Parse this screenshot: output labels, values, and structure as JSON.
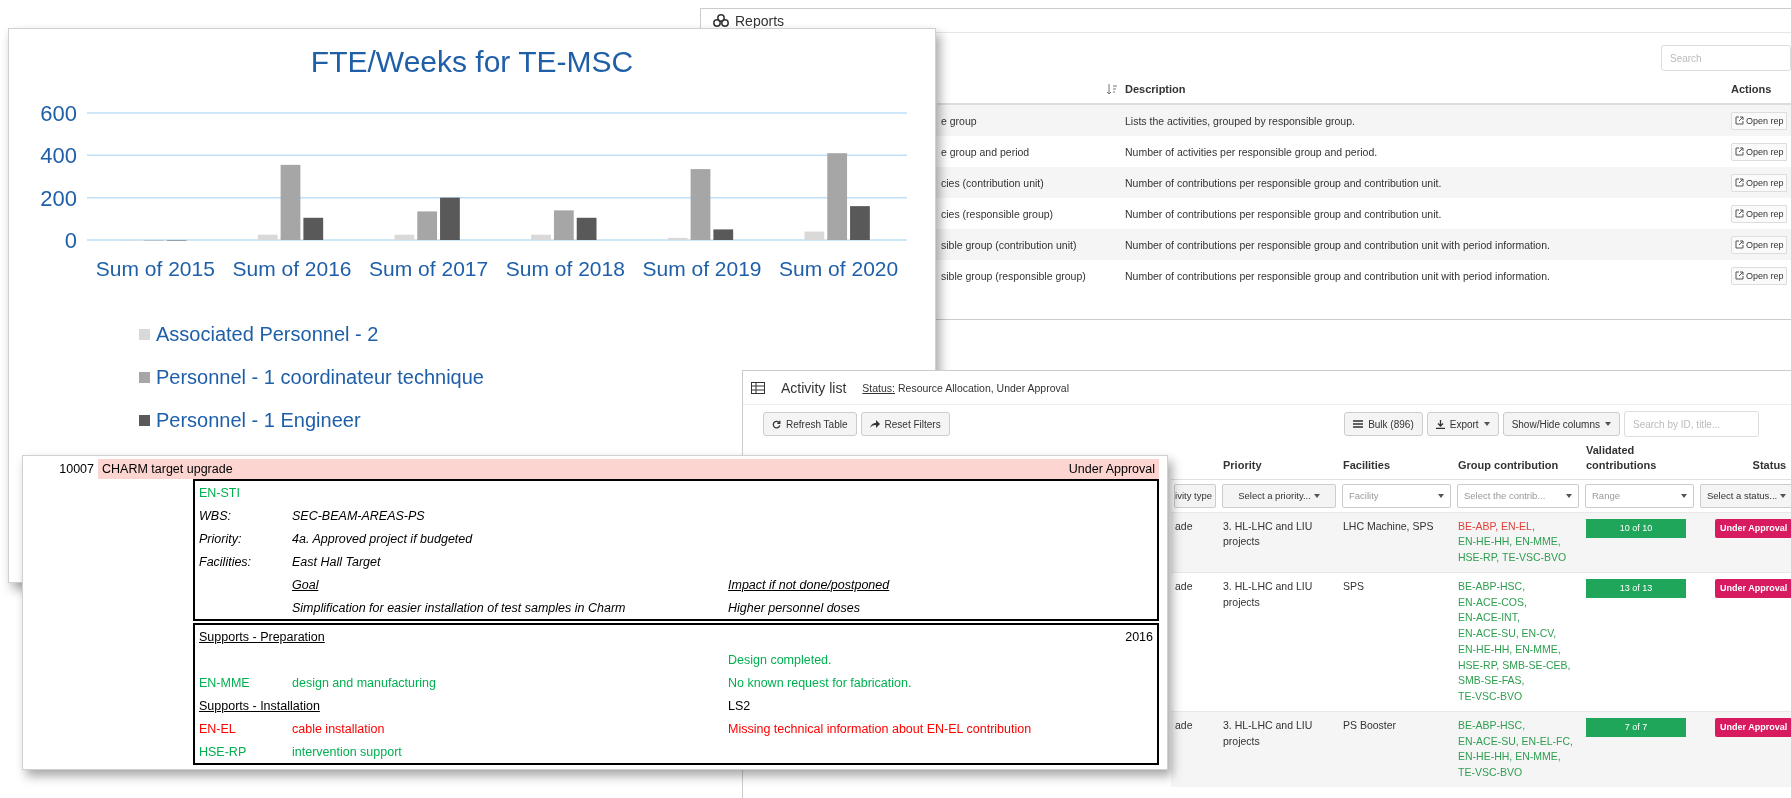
{
  "reports": {
    "title": "Reports",
    "search": {
      "placeholder": "Search"
    },
    "columns": [
      "Description",
      "Actions"
    ],
    "rows": [
      {
        "name": "e group",
        "description": "Lists the activities, grouped by responsible group.",
        "action": "Open rep"
      },
      {
        "name": "e group and period",
        "description": "Number of activities per responsible group and period.",
        "action": "Open rep"
      },
      {
        "name": "cies (contribution unit)",
        "description": "Number of contributions per responsible group and contribution unit.",
        "action": "Open rep"
      },
      {
        "name": "cies (responsible group)",
        "description": "Number of contributions per responsible group and contribution unit.",
        "action": "Open rep"
      },
      {
        "name": "sible group (contribution unit)",
        "description": "Number of contributions per responsible group and contribution unit with period information.",
        "action": "Open rep"
      },
      {
        "name": "sible group (responsible group)",
        "description": "Number of contributions per responsible group and contribution unit with period information.",
        "action": "Open rep"
      }
    ]
  },
  "chart": {
    "chart_data": {
      "type": "bar",
      "title": "FTE/Weeks for TE-MSC",
      "categories": [
        "Sum of 2015",
        "Sum of 2016",
        "Sum of 2017",
        "Sum of 2018",
        "Sum of 2019",
        "Sum of 2020"
      ],
      "ylim": [
        0,
        600
      ],
      "yticks": [
        0,
        200,
        400,
        600
      ],
      "series": [
        {
          "name": "Associated Personnel - 2",
          "color": "#d9d9d9",
          "values": [
            0,
            25,
            25,
            25,
            10,
            40
          ]
        },
        {
          "name": "Personnel - 1 coordinateur technique",
          "color": "#a6a6a6",
          "values": [
            0,
            355,
            135,
            140,
            335,
            410
          ]
        },
        {
          "name": "Personnel - 1 Engineer",
          "color": "#595959",
          "values": [
            0,
            105,
            200,
            105,
            50,
            160
          ]
        }
      ]
    }
  },
  "activity_list": {
    "title": "Activity list",
    "status_label": "Status:",
    "status_value": "Resource Allocation, Under Approval",
    "toolbar_left": [
      "Refresh Table",
      "Reset Filters"
    ],
    "bulk": "Bulk (896)",
    "export": "Export",
    "show_hide": "Show/Hide columns",
    "search": {
      "placeholder": "Search by ID, title..."
    },
    "columns": [
      "Priority",
      "Facilities",
      "Group contribution",
      "Validated contributions",
      "Status"
    ],
    "filters": [
      {
        "text": "ivity type",
        "kind": "select"
      },
      {
        "text": "Select a priority...",
        "kind": "select"
      },
      {
        "text": "Facility",
        "kind": "input"
      },
      {
        "text": "Select the contrib...",
        "kind": "input"
      },
      {
        "text": "Range",
        "kind": "input"
      },
      {
        "text": "Select a status...",
        "kind": "select"
      }
    ],
    "rows": [
      {
        "name": "ade",
        "priority": "3. HL-LHC and LIU projects",
        "facilities": "LHC Machine, SPS",
        "groups": [
          {
            "text": "BE-ABP,",
            "color": "#e0403a"
          },
          {
            "text": "EN-EL,",
            "color": "#e0403a"
          },
          {
            "text": "EN-HE-HH,",
            "color": "#2e9e4f"
          },
          {
            "text": "EN-MME,",
            "color": "#2e9e4f"
          },
          {
            "text": "HSE-RP,",
            "color": "#2e9e4f"
          },
          {
            "text": "TE-VSC-BVO",
            "color": "#2e9e4f"
          }
        ],
        "validated": "10 of 10",
        "status": "Under Approval"
      },
      {
        "name": "ade",
        "priority": "3. HL-LHC and LIU projects",
        "facilities": "SPS",
        "groups": [
          {
            "text": "BE-ABP-HSC,",
            "color": "#2e9e4f"
          },
          {
            "text": "EN-ACE-COS,",
            "color": "#2e9e4f"
          },
          {
            "text": "EN-ACE-INT,",
            "color": "#2e9e4f"
          },
          {
            "text": "EN-ACE-SU,",
            "color": "#2e9e4f"
          },
          {
            "text": "EN-CV,",
            "color": "#2e9e4f"
          },
          {
            "text": "EN-HE-HH,",
            "color": "#2e9e4f"
          },
          {
            "text": "EN-MME,",
            "color": "#2e9e4f"
          },
          {
            "text": "HSE-RP,",
            "color": "#2e9e4f"
          },
          {
            "text": "SMB-SE-CEB,",
            "color": "#2e9e4f"
          },
          {
            "text": "SMB-SE-FAS,",
            "color": "#2e9e4f"
          },
          {
            "text": "TE-VSC-BVO",
            "color": "#2e9e4f"
          }
        ],
        "validated": "13 of 13",
        "status": "Under Approval"
      },
      {
        "name": "ade",
        "priority": "3. HL-LHC and LIU projects",
        "facilities": "PS Booster",
        "groups": [
          {
            "text": "BE-ABP-HSC,",
            "color": "#2e9e4f"
          },
          {
            "text": "EN-ACE-SU,",
            "color": "#2e9e4f"
          },
          {
            "text": "EN-EL-FC,",
            "color": "#2e9e4f"
          },
          {
            "text": "EN-HE-HH,",
            "color": "#2e9e4f"
          },
          {
            "text": "EN-MME,",
            "color": "#2e9e4f"
          },
          {
            "text": "TE-VSC-BVO",
            "color": "#2e9e4f"
          }
        ],
        "validated": "7 of 7",
        "status": "Under Approval"
      }
    ]
  },
  "activity_card": {
    "id": "10007",
    "title": "CHARM target upgrade",
    "status": "Under Approval",
    "group": {
      "text": "EN-STI",
      "color": "#00b050"
    },
    "details": [
      {
        "label": "WBS:",
        "value": "SEC-BEAM-AREAS-PS"
      },
      {
        "label": "Priority:",
        "value": "4a. Approved project if budgeted"
      },
      {
        "label": "Facilities:",
        "value": "East Hall Target"
      }
    ],
    "goal_heading": "Goal",
    "impact_heading": "Impact if not done/postponed",
    "goal": "Simplification for easier installation of test samples in Charm",
    "impact": "Higher personnel doses",
    "sections": [
      {
        "title": "Supports - Preparation",
        "year": "2016",
        "lines": [
          {
            "note": "Design completed.",
            "color": "#00b050"
          },
          {
            "group": "EN-MME",
            "task": "design and manufacturing",
            "note": "No known request for fabrication.",
            "color": "#00b050"
          }
        ]
      },
      {
        "title": "Supports - Installation",
        "phase": "LS2",
        "lines": [
          {
            "group": "EN-EL",
            "task": "cable installation",
            "note": "Missing technical information about EN-EL contribution",
            "color": "#ff0000"
          },
          {
            "group": "HSE-RP",
            "task": "intervention support",
            "color": "#00b050"
          }
        ]
      }
    ]
  }
}
